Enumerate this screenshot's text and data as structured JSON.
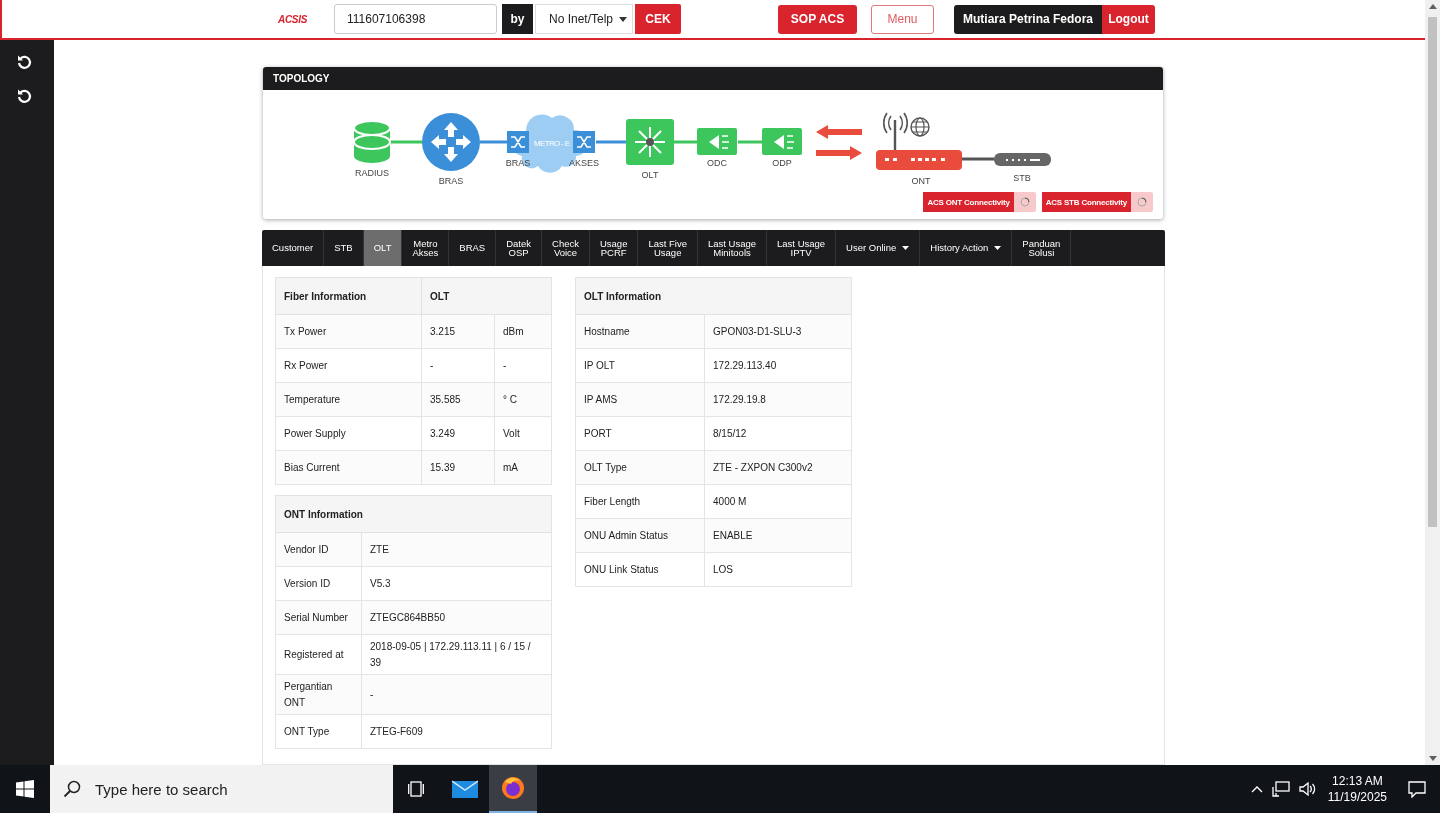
{
  "header": {
    "logo": "ACSIS",
    "search": {
      "value": "111607106398"
    },
    "by_label": "by",
    "search_type": "No Inet/Telp",
    "check_button": "CEK",
    "sop_button": "SOP ACS",
    "menu_button": "Menu",
    "user_name": "Mutiara Petrina Fedora",
    "logout_button": "Logout"
  },
  "topology": {
    "title": "TOPOLOGY",
    "nodes": [
      {
        "kind": "database",
        "label": "RADIUS"
      },
      {
        "kind": "router",
        "label": "BRAS"
      },
      {
        "kind": "switch",
        "label": "BRAS"
      },
      {
        "kind": "cloud",
        "label": "METRO - E"
      },
      {
        "kind": "switch",
        "label": "AKSES"
      },
      {
        "kind": "olt",
        "label": "OLT"
      },
      {
        "kind": "splitter",
        "label": "ODC"
      },
      {
        "kind": "splitter",
        "label": "ODP"
      },
      {
        "kind": "ont",
        "label": "ONT"
      },
      {
        "kind": "stb",
        "label": "STB"
      }
    ],
    "badges": [
      "ACS ONT Connectivity",
      "ACS STB Connectivity"
    ]
  },
  "tabs": [
    {
      "label": "Customer",
      "selected": false,
      "dropdown": false
    },
    {
      "label": "STB",
      "selected": false,
      "dropdown": false
    },
    {
      "label": "OLT",
      "selected": true,
      "dropdown": false
    },
    {
      "label": "Metro\nAkses",
      "selected": false,
      "dropdown": false
    },
    {
      "label": "BRAS",
      "selected": false,
      "dropdown": false
    },
    {
      "label": "Datek\nOSP",
      "selected": false,
      "dropdown": false
    },
    {
      "label": "Check\nVoice",
      "selected": false,
      "dropdown": false
    },
    {
      "label": "Usage\nPCRF",
      "selected": false,
      "dropdown": false
    },
    {
      "label": "Last Five\nUsage",
      "selected": false,
      "dropdown": false
    },
    {
      "label": "Last Usage\nMinitools",
      "selected": false,
      "dropdown": false
    },
    {
      "label": "Last Usage\nIPTV",
      "selected": false,
      "dropdown": false
    },
    {
      "label": "User Online",
      "selected": false,
      "dropdown": true
    },
    {
      "label": "History Action",
      "selected": false,
      "dropdown": true
    },
    {
      "label": "Panduan\nSolusi",
      "selected": false,
      "dropdown": false
    }
  ],
  "fiber_information": {
    "columns": [
      {
        "label": "Fiber Information"
      },
      {
        "label": "OLT",
        "colspan": 2
      }
    ],
    "rows": [
      [
        "Tx Power",
        "3.215",
        "dBm"
      ],
      [
        "Rx Power",
        "-",
        "-"
      ],
      [
        "Temperature",
        "35.585",
        "° C"
      ],
      [
        "Power Supply",
        "3.249",
        "Volt"
      ],
      [
        "Bias Current",
        "15.39",
        "mA"
      ]
    ]
  },
  "ont_information": {
    "title": "ONT Information",
    "rows": [
      [
        "Vendor ID",
        "ZTE"
      ],
      [
        "Version ID",
        "V5.3"
      ],
      [
        "Serial Number",
        "ZTEGC864BB50"
      ],
      [
        "Registered at",
        "2018-09-05 | 172.29.113.11 | 6 / 15 / 39"
      ],
      [
        "Pergantian ONT",
        "-"
      ],
      [
        "ONT Type",
        "ZTEG-F609"
      ]
    ]
  },
  "olt_information": {
    "title": "OLT Information",
    "rows": [
      [
        "Hostname",
        "GPON03-D1-SLU-3"
      ],
      [
        "IP OLT",
        "172.29.113.40"
      ],
      [
        "IP AMS",
        "172.29.19.8"
      ],
      [
        "PORT",
        "8/15/12"
      ],
      [
        "OLT Type",
        "ZTE - ZXPON C300v2"
      ],
      [
        "Fiber Length",
        "4000 M"
      ],
      [
        "ONU Admin Status",
        "ENABLE"
      ],
      [
        "ONU Link Status",
        "LOS"
      ]
    ]
  },
  "taskbar": {
    "search_placeholder": "Type here to search",
    "apps": [
      {
        "kind": "task-view",
        "selected": false
      },
      {
        "kind": "mail",
        "selected": false
      },
      {
        "kind": "browser",
        "selected": true
      }
    ],
    "time": "12:13 AM",
    "date": "11/19/2025"
  }
}
